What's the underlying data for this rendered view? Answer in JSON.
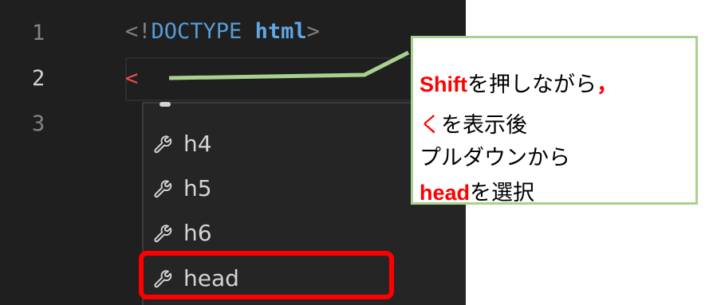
{
  "editor": {
    "line_numbers": [
      "1",
      "2",
      "3"
    ],
    "line1": {
      "open": "<!",
      "doctype": "DOCTYPE",
      "space": " ",
      "html": "html",
      "close": ">"
    },
    "line2": {
      "typed": "<"
    }
  },
  "suggestions": [
    {
      "label": "h4",
      "icon": "wrench-icon"
    },
    {
      "label": "h5",
      "icon": "wrench-icon"
    },
    {
      "label": "h6",
      "icon": "wrench-icon"
    },
    {
      "label": "head",
      "icon": "wrench-icon",
      "highlighted": true
    }
  ],
  "callout": {
    "line1_key": "Shift",
    "line1_text": "を押しながら",
    "line1_comma": "，",
    "line2_key": "く",
    "line2_text": "を表示後",
    "line3_text": "プルダウンから",
    "line4_key": "head",
    "line4_text": "を選択"
  },
  "colors": {
    "highlight_border": "#ff0000",
    "callout_border": "#a9d18e",
    "editor_bg": "#1f1f1f"
  }
}
